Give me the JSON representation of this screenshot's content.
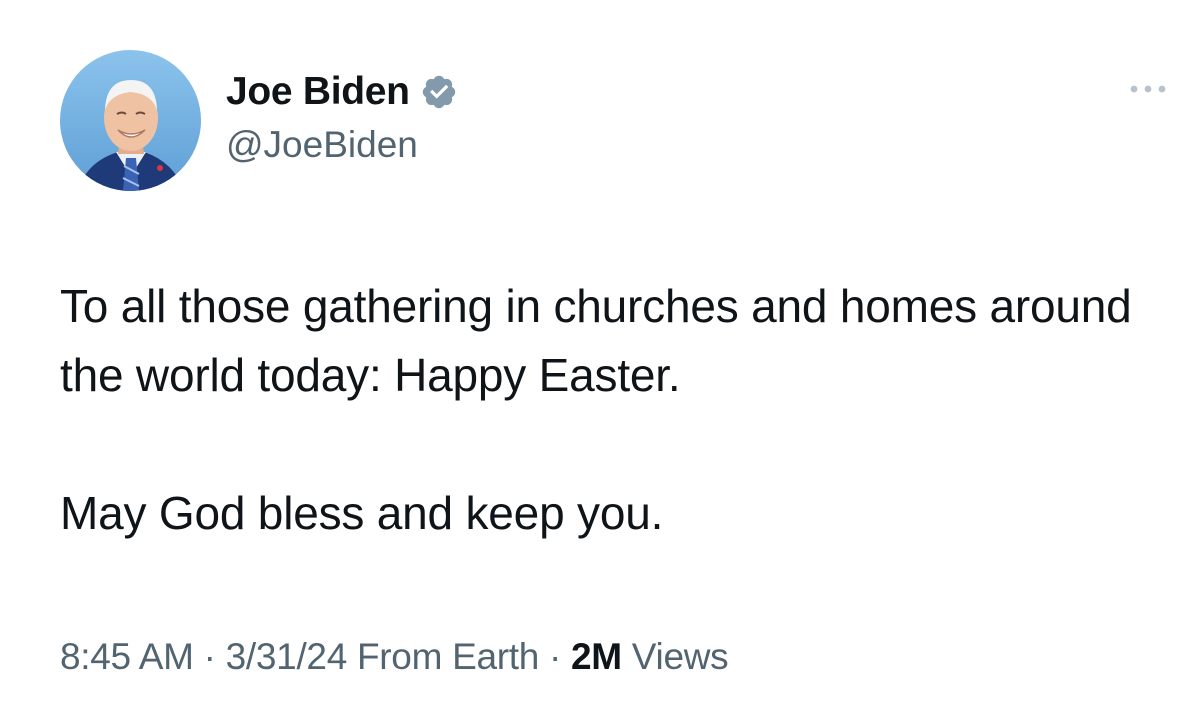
{
  "author": {
    "display_name": "Joe Biden",
    "handle": "@JoeBiden",
    "verified_icon": "verified-badge-icon",
    "avatar": "avatar-photo"
  },
  "tweet": {
    "paragraphs": [
      "To all those gathering in churches and homes around the world today: Happy Easter.",
      "May God bless and keep you."
    ]
  },
  "meta": {
    "time": "8:45 AM",
    "sep1": " · ",
    "date": "3/31/24",
    "source": " From Earth",
    "sep2": " · ",
    "views_count": "2M",
    "views_label": " Views"
  },
  "menu": {
    "icon": "more-options-icon"
  },
  "colors": {
    "text_primary": "#0f1419",
    "text_secondary": "#536471",
    "verified_badge": "#829aab",
    "background": "#ffffff"
  }
}
